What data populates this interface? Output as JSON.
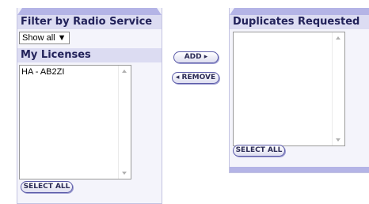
{
  "filter": {
    "heading": "Filter by Radio Service",
    "select_value": "Show all ▼"
  },
  "licenses": {
    "heading": "My Licenses",
    "items": [
      "HA - AB2ZI"
    ],
    "select_all_label": "SELECT ALL"
  },
  "transfer": {
    "add_label": "ADD ▸",
    "remove_label": "◂ REMOVE"
  },
  "duplicates": {
    "heading": "Duplicates Requested",
    "select_all_label": "SELECT ALL"
  }
}
